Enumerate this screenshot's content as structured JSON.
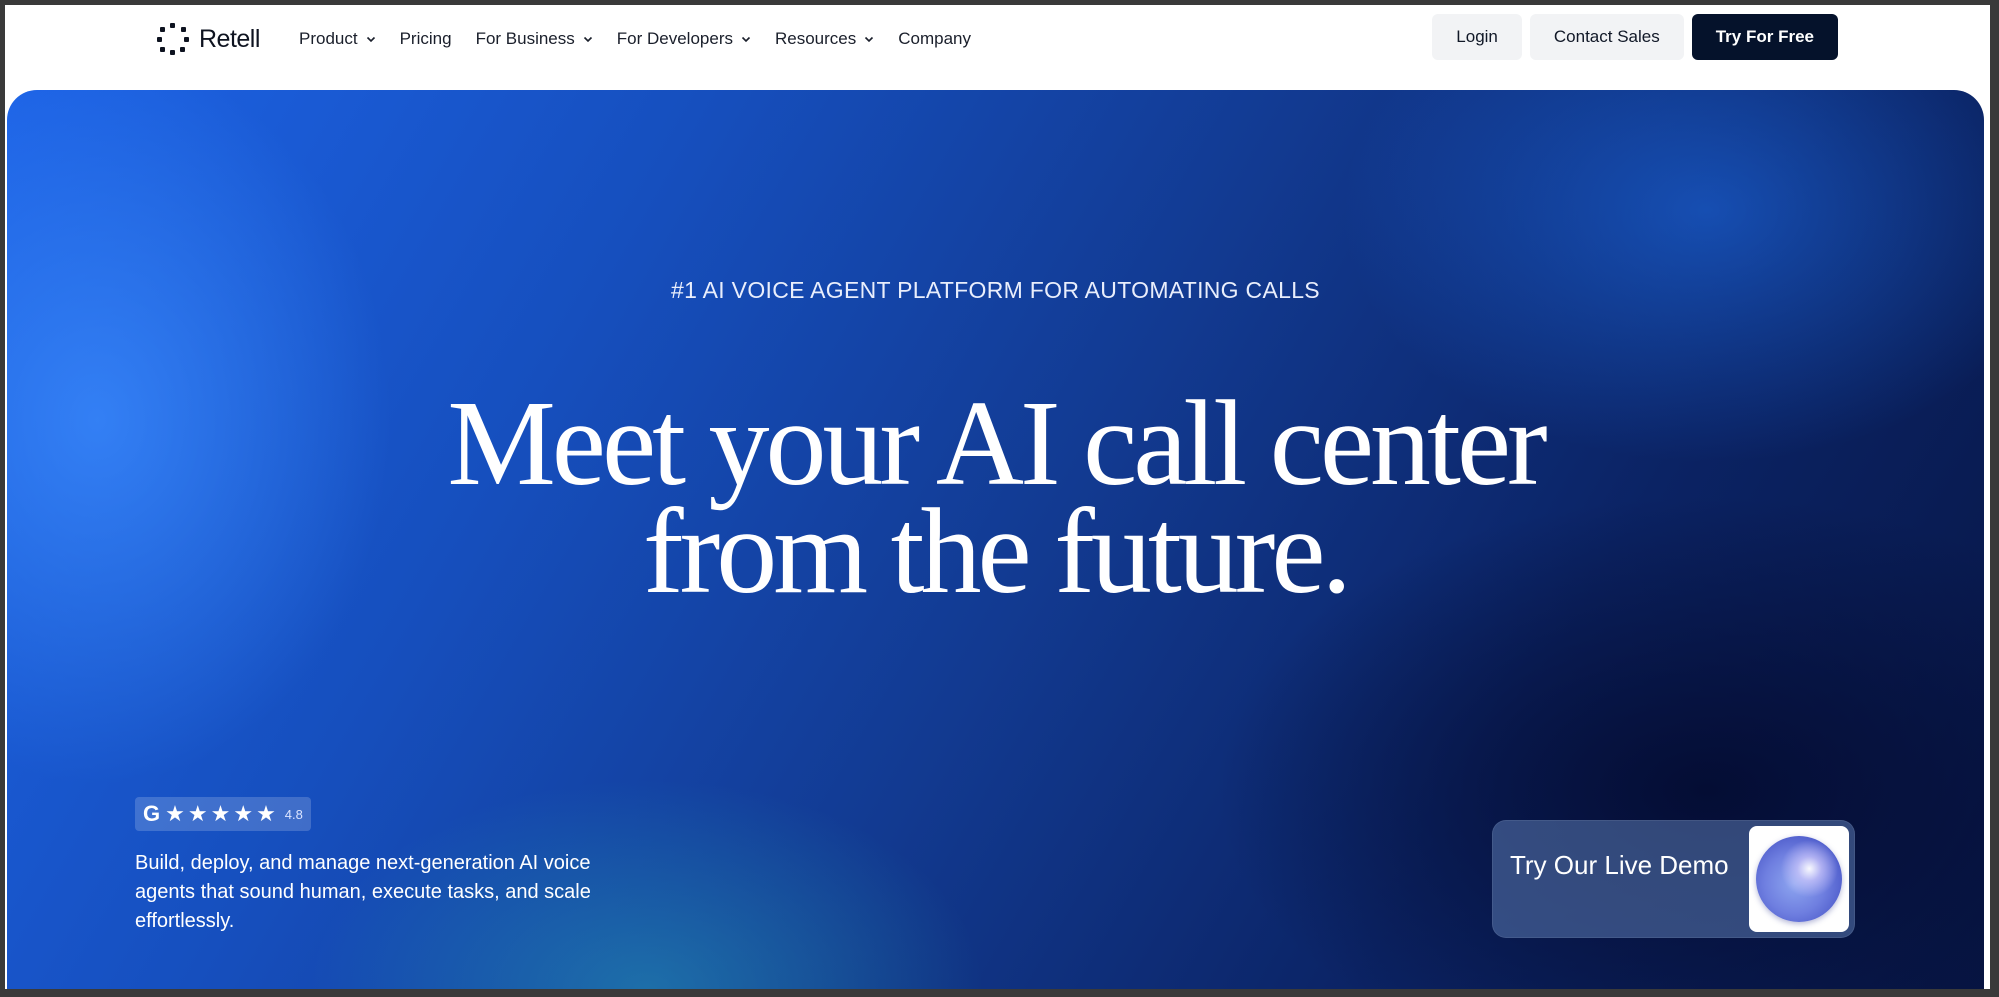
{
  "nav": {
    "brand": "Retell",
    "items": [
      {
        "label": "Product",
        "dropdown": true
      },
      {
        "label": "Pricing",
        "dropdown": false
      },
      {
        "label": "For Business",
        "dropdown": true
      },
      {
        "label": "For Developers",
        "dropdown": true
      },
      {
        "label": "Resources",
        "dropdown": true
      },
      {
        "label": "Company",
        "dropdown": false
      }
    ],
    "login": "Login",
    "contact_sales": "Contact Sales",
    "try_free": "Try For Free"
  },
  "hero": {
    "eyebrow": "#1 AI VOICE AGENT PLATFORM FOR AUTOMATING CALLS",
    "headline_line1": "Meet your AI call center",
    "headline_line2": "from the future.",
    "rating": {
      "badge": "G",
      "stars": 5,
      "score": "4.8"
    },
    "description": "Build, deploy, and manage next-generation AI voice agents that sound human, execute tasks, and scale effortlessly.",
    "demo_label": "Try Our Live Demo"
  },
  "colors": {
    "accent_dark": "#05122b",
    "hero_blue": "#1d63e6",
    "hero_navy": "#071543"
  },
  "icons": [
    "retell-logo-icon",
    "chevron-down-icon",
    "g2-icon",
    "star-icon",
    "voice-orb-icon"
  ]
}
